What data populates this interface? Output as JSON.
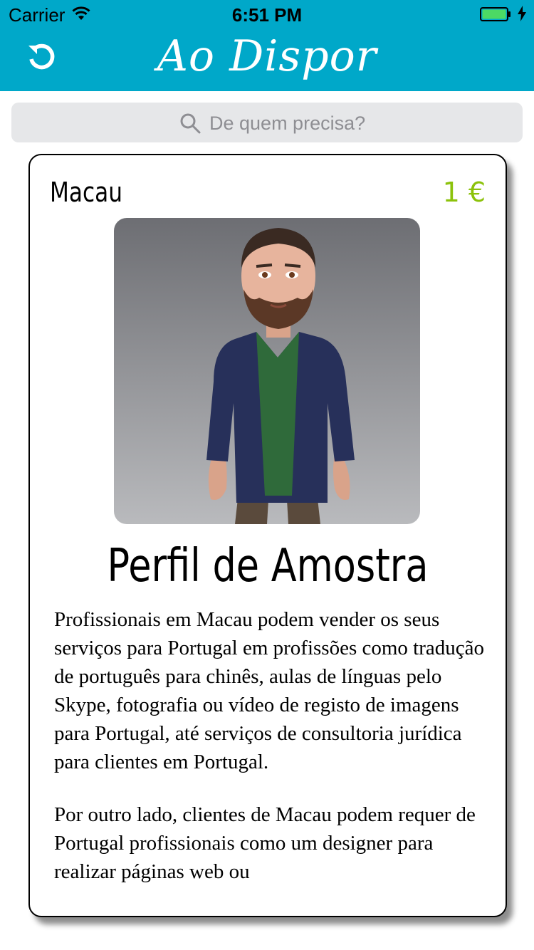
{
  "status_bar": {
    "carrier": "Carrier",
    "time": "6:51 PM",
    "battery_color": "#4cd964"
  },
  "header": {
    "title": "Ao Dispor",
    "background": "#00a8c9",
    "refresh_icon": "refresh-icon"
  },
  "search": {
    "placeholder": "De quem precisa?",
    "value": "",
    "icon": "search-icon"
  },
  "card": {
    "location": "Macau",
    "price": "1 €",
    "price_color": "#8cc20b",
    "avatar": "avatar-image",
    "name": "Perfil de Amostra",
    "paragraphs": [
      "Profissionais em Macau podem vender os seus serviços para Portugal em profissões como tradução de português para chinês, aulas de línguas pelo Skype, fotografia ou vídeo de registo de imagens para Portugal, até serviços de consultoria jurídica para clientes em Portugal.",
      "Por outro lado, clientes de Macau podem requer de Portugal profissionais como um designer para realizar páginas web ou"
    ]
  }
}
